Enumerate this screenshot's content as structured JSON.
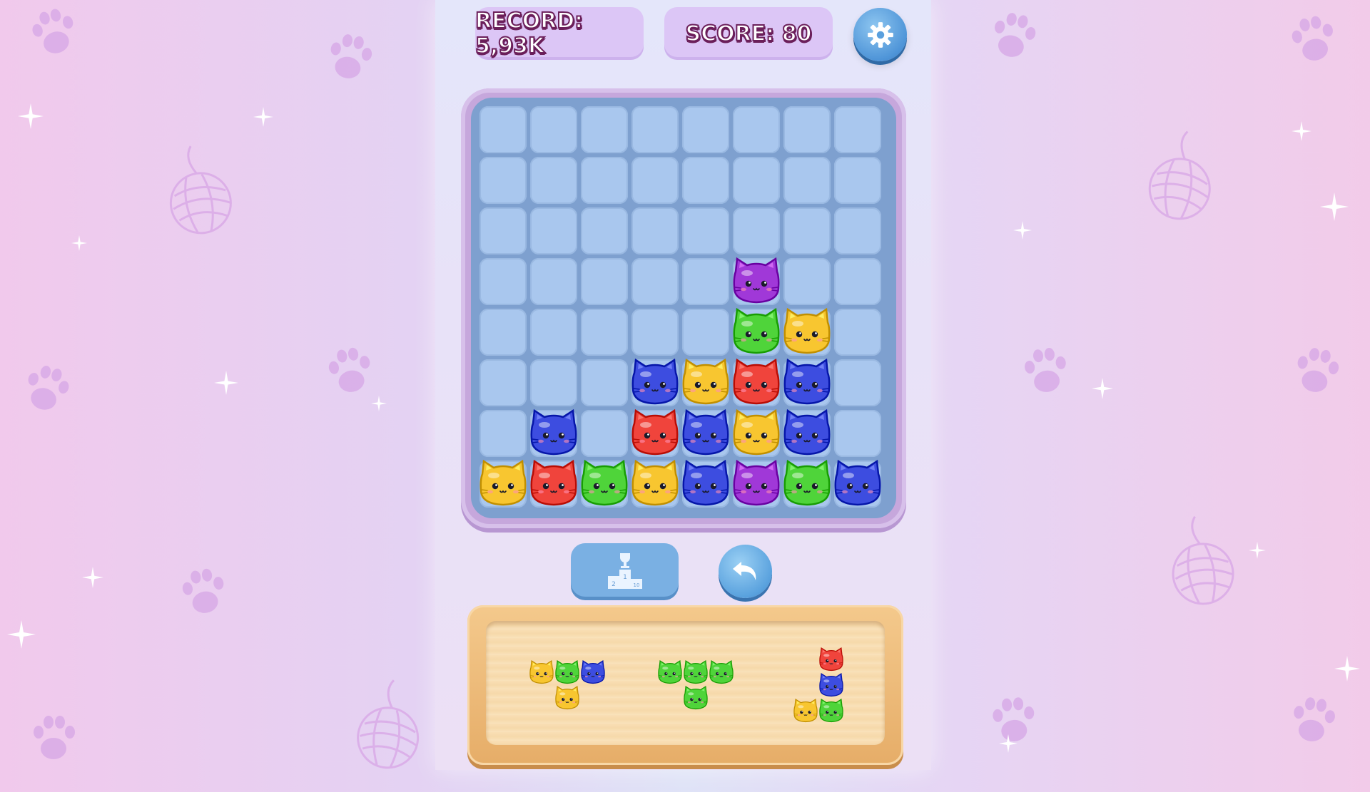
{
  "header": {
    "record_label": "RECORD: 5,93K",
    "score_label": "SCORE: 80"
  },
  "icons": {
    "settings": "gear-icon",
    "leaderboard": "podium-icon",
    "undo": "undo-arrow-icon"
  },
  "leaderboard_podium": {
    "left": "2",
    "center": "1",
    "right": "10"
  },
  "colors": {
    "yellow": "#f8c630",
    "red": "#f0443c",
    "green": "#4fd43a",
    "blue": "#3d4de0",
    "purple": "#a038d8"
  },
  "board": {
    "rows": 8,
    "cols": 8,
    "grid": [
      [
        null,
        null,
        null,
        null,
        null,
        null,
        null,
        null
      ],
      [
        null,
        null,
        null,
        null,
        null,
        null,
        null,
        null
      ],
      [
        null,
        null,
        null,
        null,
        null,
        null,
        null,
        null
      ],
      [
        null,
        null,
        null,
        null,
        null,
        "purple",
        null,
        null
      ],
      [
        null,
        null,
        null,
        null,
        null,
        "green",
        "yellow",
        null
      ],
      [
        null,
        null,
        null,
        "blue",
        "yellow",
        "red",
        "blue",
        null
      ],
      [
        null,
        "blue",
        null,
        "red",
        "blue",
        "yellow",
        "blue",
        null
      ],
      [
        "yellow",
        "red",
        "green",
        "yellow",
        "blue",
        "purple",
        "green",
        "blue"
      ]
    ]
  },
  "tray": {
    "pieces": [
      {
        "cells": [
          [
            0,
            0,
            "yellow"
          ],
          [
            0,
            1,
            "green"
          ],
          [
            0,
            2,
            "blue"
          ],
          [
            1,
            1,
            "yellow"
          ]
        ]
      },
      {
        "cells": [
          [
            0,
            0,
            "green"
          ],
          [
            0,
            1,
            "green"
          ],
          [
            0,
            2,
            "green"
          ],
          [
            1,
            1,
            "green"
          ]
        ]
      },
      {
        "cells": [
          [
            0,
            1,
            "red"
          ],
          [
            1,
            1,
            "blue"
          ],
          [
            2,
            0,
            "yellow"
          ],
          [
            2,
            1,
            "green"
          ]
        ]
      }
    ]
  }
}
